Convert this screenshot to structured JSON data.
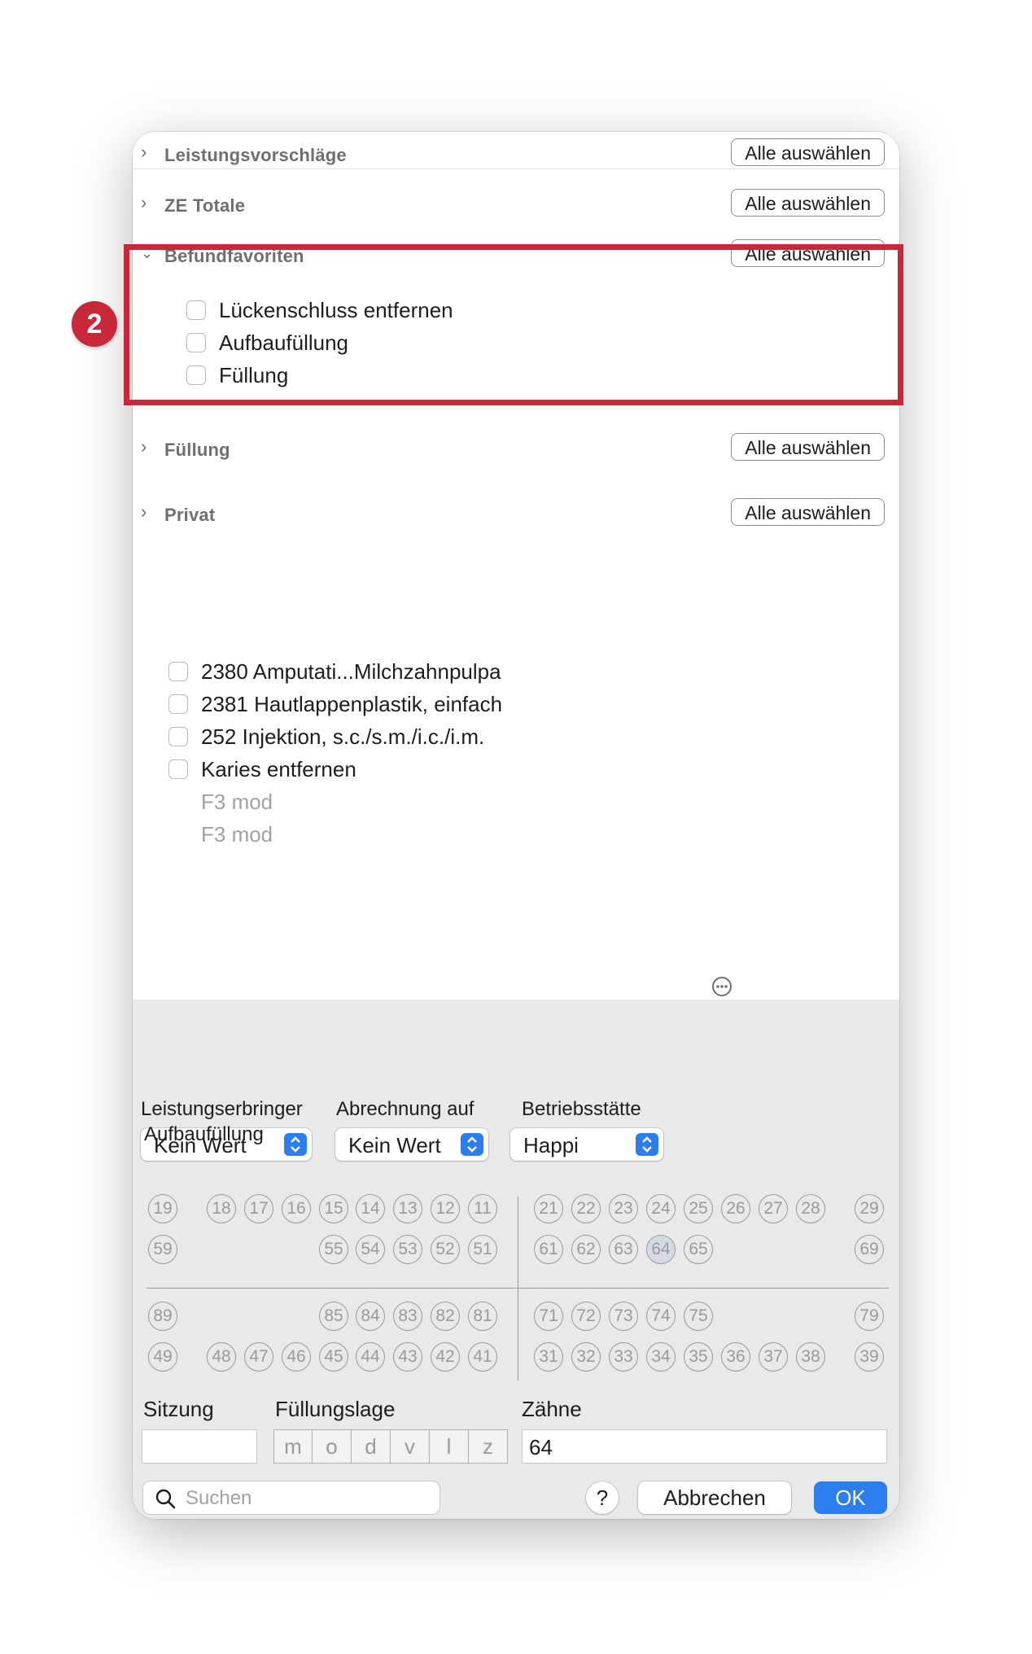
{
  "sections": [
    {
      "id": "leistungsvorschlaege",
      "title": "Leistungsvorschläge",
      "expanded": false
    },
    {
      "id": "ze-totale",
      "title": "ZE Totale",
      "expanded": false
    },
    {
      "id": "befundfavoriten",
      "title": "Befundfavoriten",
      "expanded": true,
      "items": [
        "Lückenschluss entfernen",
        "Aufbaufüllung",
        "Füllung"
      ]
    },
    {
      "id": "fuellung",
      "title": "Füllung",
      "expanded": false
    },
    {
      "id": "privat",
      "title": "Privat",
      "expanded": true,
      "items": [
        "2380 Amputati...Milchzahnpulpa",
        "2381 Hautlappenplastik, einfach",
        "252 Injektion, s.c./s.m./i.c./i.m.",
        "Karies entfernen"
      ],
      "subitems": [
        "F3 mod",
        "F3 mod"
      ]
    }
  ],
  "select_all_label": "Alle auswählen",
  "badge": "2",
  "form": {
    "leistungserbringer": {
      "label": "Leistungserbringer",
      "value": "Kein Wert",
      "overlap_text": "Aufbaufüllung"
    },
    "abrechnung": {
      "label": "Abrechnung auf",
      "value": "Kein Wert"
    },
    "betriebsstaette": {
      "label": "Betriebsstätte",
      "value": "Happi"
    },
    "sitzung": {
      "label": "Sitzung",
      "value": ""
    },
    "fuellungslage": {
      "label": "Füllungslage",
      "segments": [
        "m",
        "o",
        "d",
        "v",
        "l",
        "z"
      ]
    },
    "zaehne": {
      "label": "Zähne",
      "value": "64"
    }
  },
  "teeth": {
    "row1": [
      "19",
      "18",
      "17",
      "16",
      "15",
      "14",
      "13",
      "12",
      "11",
      "21",
      "22",
      "23",
      "24",
      "25",
      "26",
      "27",
      "28",
      "29"
    ],
    "row2": [
      "59",
      "55",
      "54",
      "53",
      "52",
      "51",
      "61",
      "62",
      "63",
      "64",
      "65",
      "69"
    ],
    "row3": [
      "89",
      "85",
      "84",
      "83",
      "82",
      "81",
      "71",
      "72",
      "73",
      "74",
      "75",
      "79"
    ],
    "row4": [
      "49",
      "48",
      "47",
      "46",
      "45",
      "44",
      "43",
      "42",
      "41",
      "31",
      "32",
      "33",
      "34",
      "35",
      "36",
      "37",
      "38",
      "39"
    ],
    "selected": "64"
  },
  "footer": {
    "search_placeholder": "Suchen",
    "help": "?",
    "cancel": "Abbrechen",
    "ok": "OK"
  },
  "colors": {
    "accent": "#2c7df0",
    "highlight": "#c8283a"
  }
}
